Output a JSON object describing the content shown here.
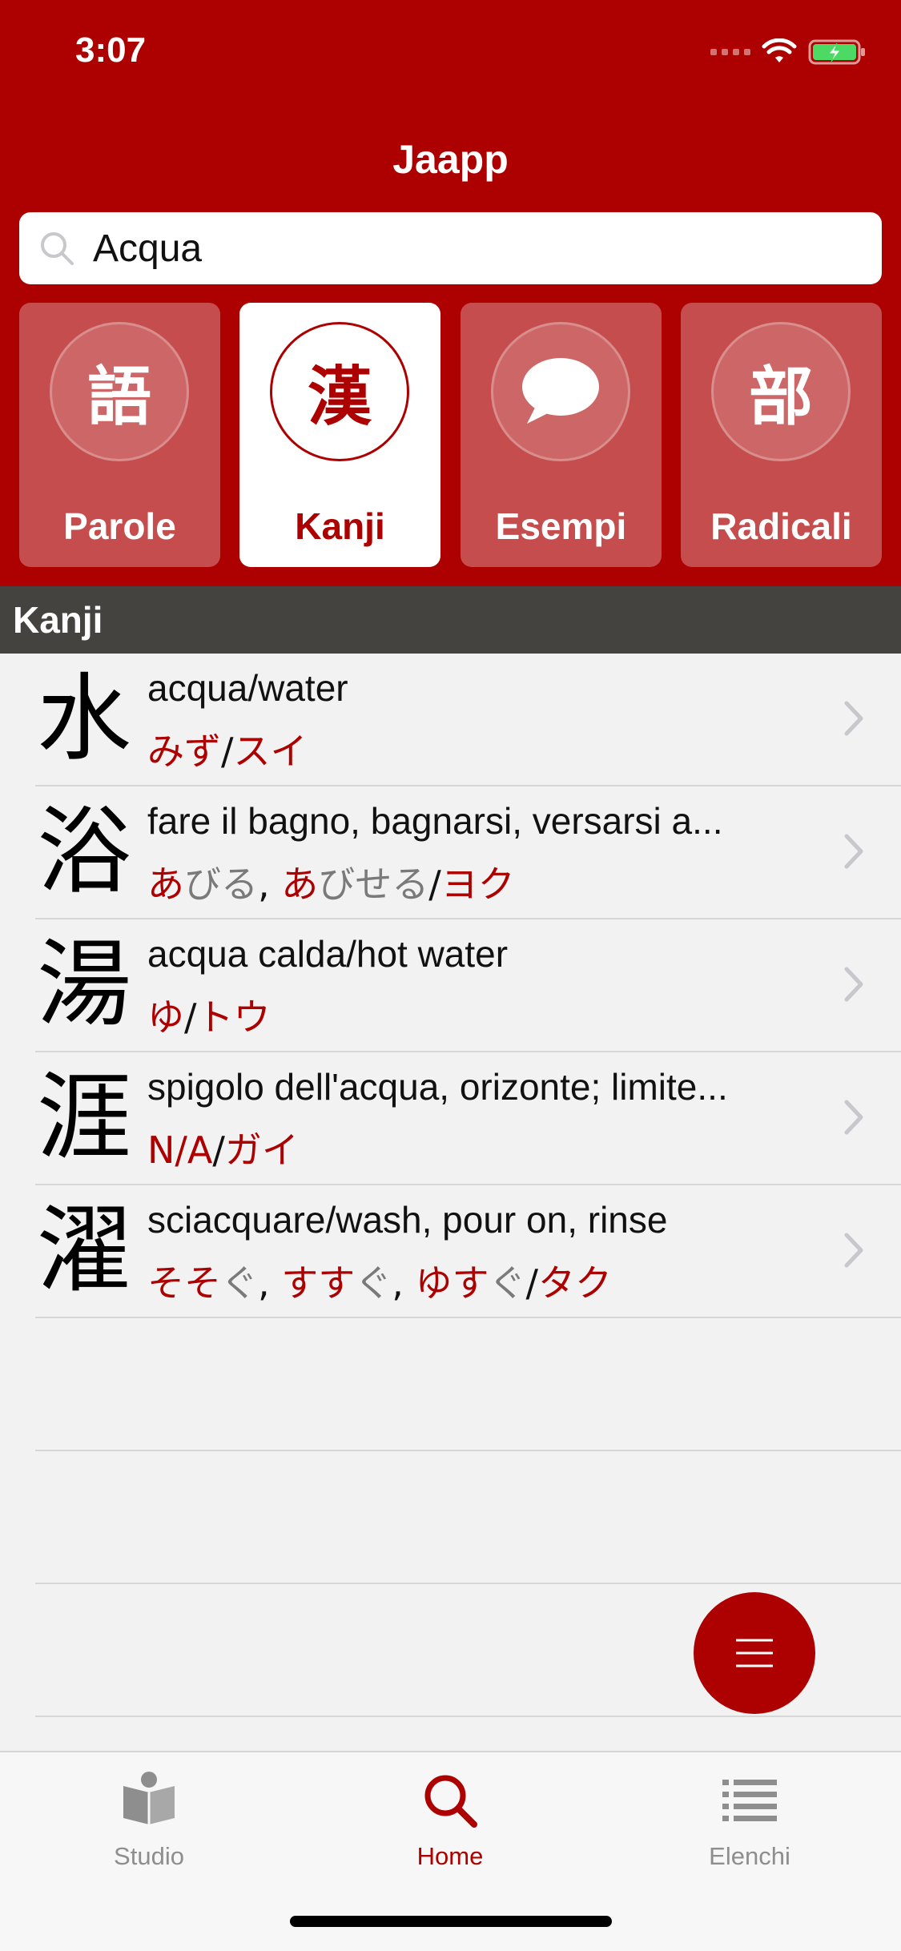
{
  "status": {
    "time": "3:07"
  },
  "header": {
    "title": "Jaapp"
  },
  "search": {
    "value": "Acqua",
    "icon": "search-icon"
  },
  "categories": [
    {
      "glyph": "語",
      "label": "Parole",
      "active": false
    },
    {
      "glyph": "漢",
      "label": "Kanji",
      "active": true
    },
    {
      "glyph": "",
      "label": "Esempi",
      "active": false,
      "icon": "speech-bubble-icon"
    },
    {
      "glyph": "部",
      "label": "Radicali",
      "active": false
    }
  ],
  "section": {
    "title": "Kanji"
  },
  "kanji_list": [
    {
      "kanji": "水",
      "meaning": "acqua/water",
      "kun": [
        {
          "text": "みず",
          "style": "red"
        }
      ],
      "sep": "/",
      "on": "スイ"
    },
    {
      "kanji": "浴",
      "meaning": "fare il bagno, bagnarsi, versarsi a...",
      "kun": [
        {
          "text": "あ",
          "style": "red"
        },
        {
          "text": "びる",
          "style": "gray"
        },
        {
          "text": ", ",
          "style": "sep"
        },
        {
          "text": "あ",
          "style": "red"
        },
        {
          "text": "びせる",
          "style": "gray"
        }
      ],
      "sep": "/",
      "on": "ヨク"
    },
    {
      "kanji": "湯",
      "meaning": "acqua calda/hot water",
      "kun": [
        {
          "text": "ゆ",
          "style": "red"
        }
      ],
      "sep": "/",
      "on": "トウ"
    },
    {
      "kanji": "涯",
      "meaning": "spigolo dell'acqua, orizonte; limite...",
      "kun": [
        {
          "text": "N/A",
          "style": "red"
        }
      ],
      "sep": "/",
      "on": "ガイ"
    },
    {
      "kanji": "濯",
      "meaning": "sciacquare/wash, pour on, rinse",
      "kun": [
        {
          "text": "そそ",
          "style": "red"
        },
        {
          "text": "ぐ",
          "style": "gray"
        },
        {
          "text": ", ",
          "style": "sep"
        },
        {
          "text": "すす",
          "style": "red"
        },
        {
          "text": "ぐ",
          "style": "gray"
        },
        {
          "text": ", ",
          "style": "sep"
        },
        {
          "text": "ゆす",
          "style": "red"
        },
        {
          "text": "ぐ",
          "style": "gray"
        }
      ],
      "sep": "/",
      "on": "タク"
    }
  ],
  "fab": {
    "icon": "menu-icon"
  },
  "tabbar": {
    "tabs": [
      {
        "label": "Studio",
        "icon": "book-reader-icon",
        "active": false
      },
      {
        "label": "Home",
        "icon": "search-icon",
        "active": true
      },
      {
        "label": "Elenchi",
        "icon": "list-icon",
        "active": false
      }
    ]
  },
  "colors": {
    "accent": "#ad0000",
    "section_header": "#444340",
    "reading_gray": "#7a7a7a"
  }
}
